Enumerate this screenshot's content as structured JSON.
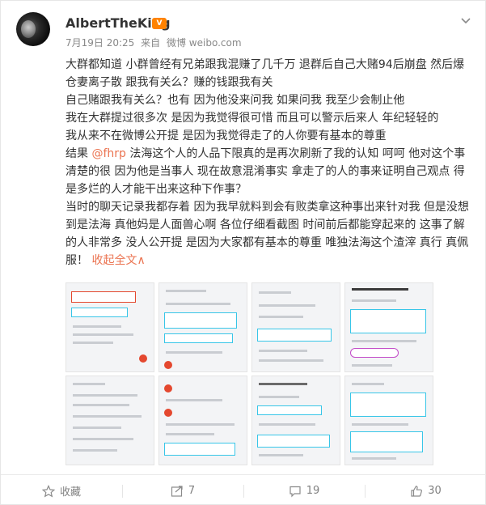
{
  "post": {
    "username": "AlbertTheKing",
    "vip_label": "V",
    "date": "7月19日 20:25",
    "source_prefix": "来自",
    "source": "微博 weibo.com",
    "lines": [
      "大群都知道 小群曾经有兄弟跟我混赚了几千万 退群后自己大赌94后崩盘 然后爆",
      "仓妻离子散 跟我有关么？赚的钱跟我有关",
      "自己赌跟我有关么？也有 因为他没来问我 如果问我 我至少会制止他",
      "我在大群提过很多次 是因为我觉得很可惜 而且可以警示后来人 年纪轻轻的",
      "我从来不在微博公开提 是因为我觉得走了的人你要有基本的尊重"
    ],
    "line6_prefix": "结果 ",
    "mention": "@fhrp",
    "line6_rest": " 法海这个人的人品下限真的是再次刷新了我的认知 呵呵 他对这个事",
    "lines_after": [
      "清楚的很 因为他是当事人 现在故意混淆事实 拿走了的人的事来证明自己观点  得",
      "是多烂的人才能干出来这种下作事？",
      "当时的聊天记录我都存着 因为我早就料到会有败类拿这种事出来针对我 但是没想",
      "到是法海 真他妈是人面兽心啊 各位仔细看截图 时间前后都能穿起来的 这事了解",
      "的人非常多 没人公开提 是因为大家都有基本的尊重 唯独法海这个渣滓 真行 真佩"
    ],
    "last_line_text": "服！",
    "collapse_label": "收起全文",
    "collapse_arrow": "∧"
  },
  "footer": {
    "favorite_label": "收藏",
    "repost_count": "7",
    "comment_count": "19",
    "like_count": "30"
  },
  "thumbs": [
    {
      "name": "screenshot-1"
    },
    {
      "name": "screenshot-2"
    },
    {
      "name": "screenshot-3"
    },
    {
      "name": "screenshot-4"
    },
    {
      "name": "screenshot-5"
    },
    {
      "name": "screenshot-6"
    },
    {
      "name": "screenshot-7"
    },
    {
      "name": "screenshot-8"
    }
  ],
  "colors": {
    "accent": "#eb7350",
    "vip": "#ff8200",
    "highlight_border": "#38c6e8",
    "text": "#333333",
    "meta": "#888888"
  }
}
